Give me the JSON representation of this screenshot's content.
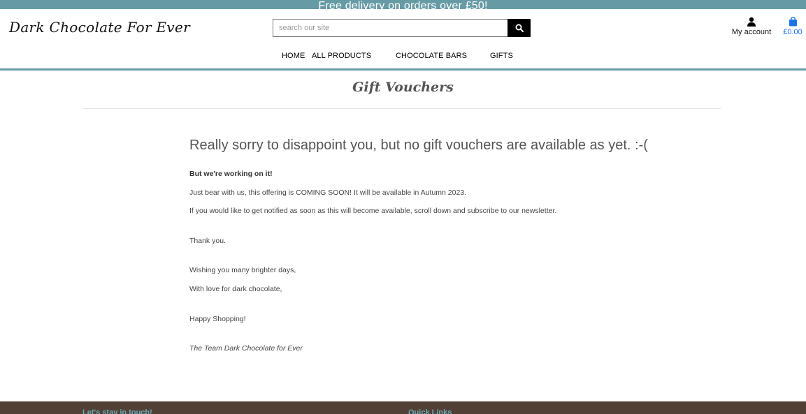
{
  "banner": {
    "text": "Free delivery on orders over £50!"
  },
  "header": {
    "logo": "Dark Chocolate For Ever",
    "search": {
      "placeholder": "search our site",
      "icon": "search-icon"
    },
    "account": {
      "label": "My account",
      "icon": "user-icon"
    },
    "bag": {
      "total": "£0.00",
      "icon": "shopping-bag-icon"
    }
  },
  "nav": {
    "items": [
      {
        "label": "HOME"
      },
      {
        "label": "ALL PRODUCTS"
      },
      {
        "label": "CHOCOLATE BARS"
      },
      {
        "label": "GIFTS"
      }
    ]
  },
  "page": {
    "title": "Gift Vouchers",
    "heading": "Really sorry to disappoint you, but no gift vouchers are available as yet. :-(",
    "subheading": "But we're working on it!",
    "lines": [
      "Just bear with us, this offering is COMING SOON! It will be available in Autumn 2023.",
      "If you would like to get notified as soon as this will become available, scroll down and subscribe to our newsletter.",
      "Thank you.",
      "Wishing you many brighter days,",
      "With love for dark chocolate,",
      "Happy Shopping!"
    ],
    "signature": "The Team Dark Chocolate for Ever"
  },
  "footer": {
    "left_heading": "Let's stay in touch!",
    "right_heading": "Quick Links"
  },
  "colors": {
    "accent": "#669ba6",
    "footer_bg": "#524037",
    "bag_blue": "#1a73e8",
    "footer_heading": "#6aa9b4"
  }
}
